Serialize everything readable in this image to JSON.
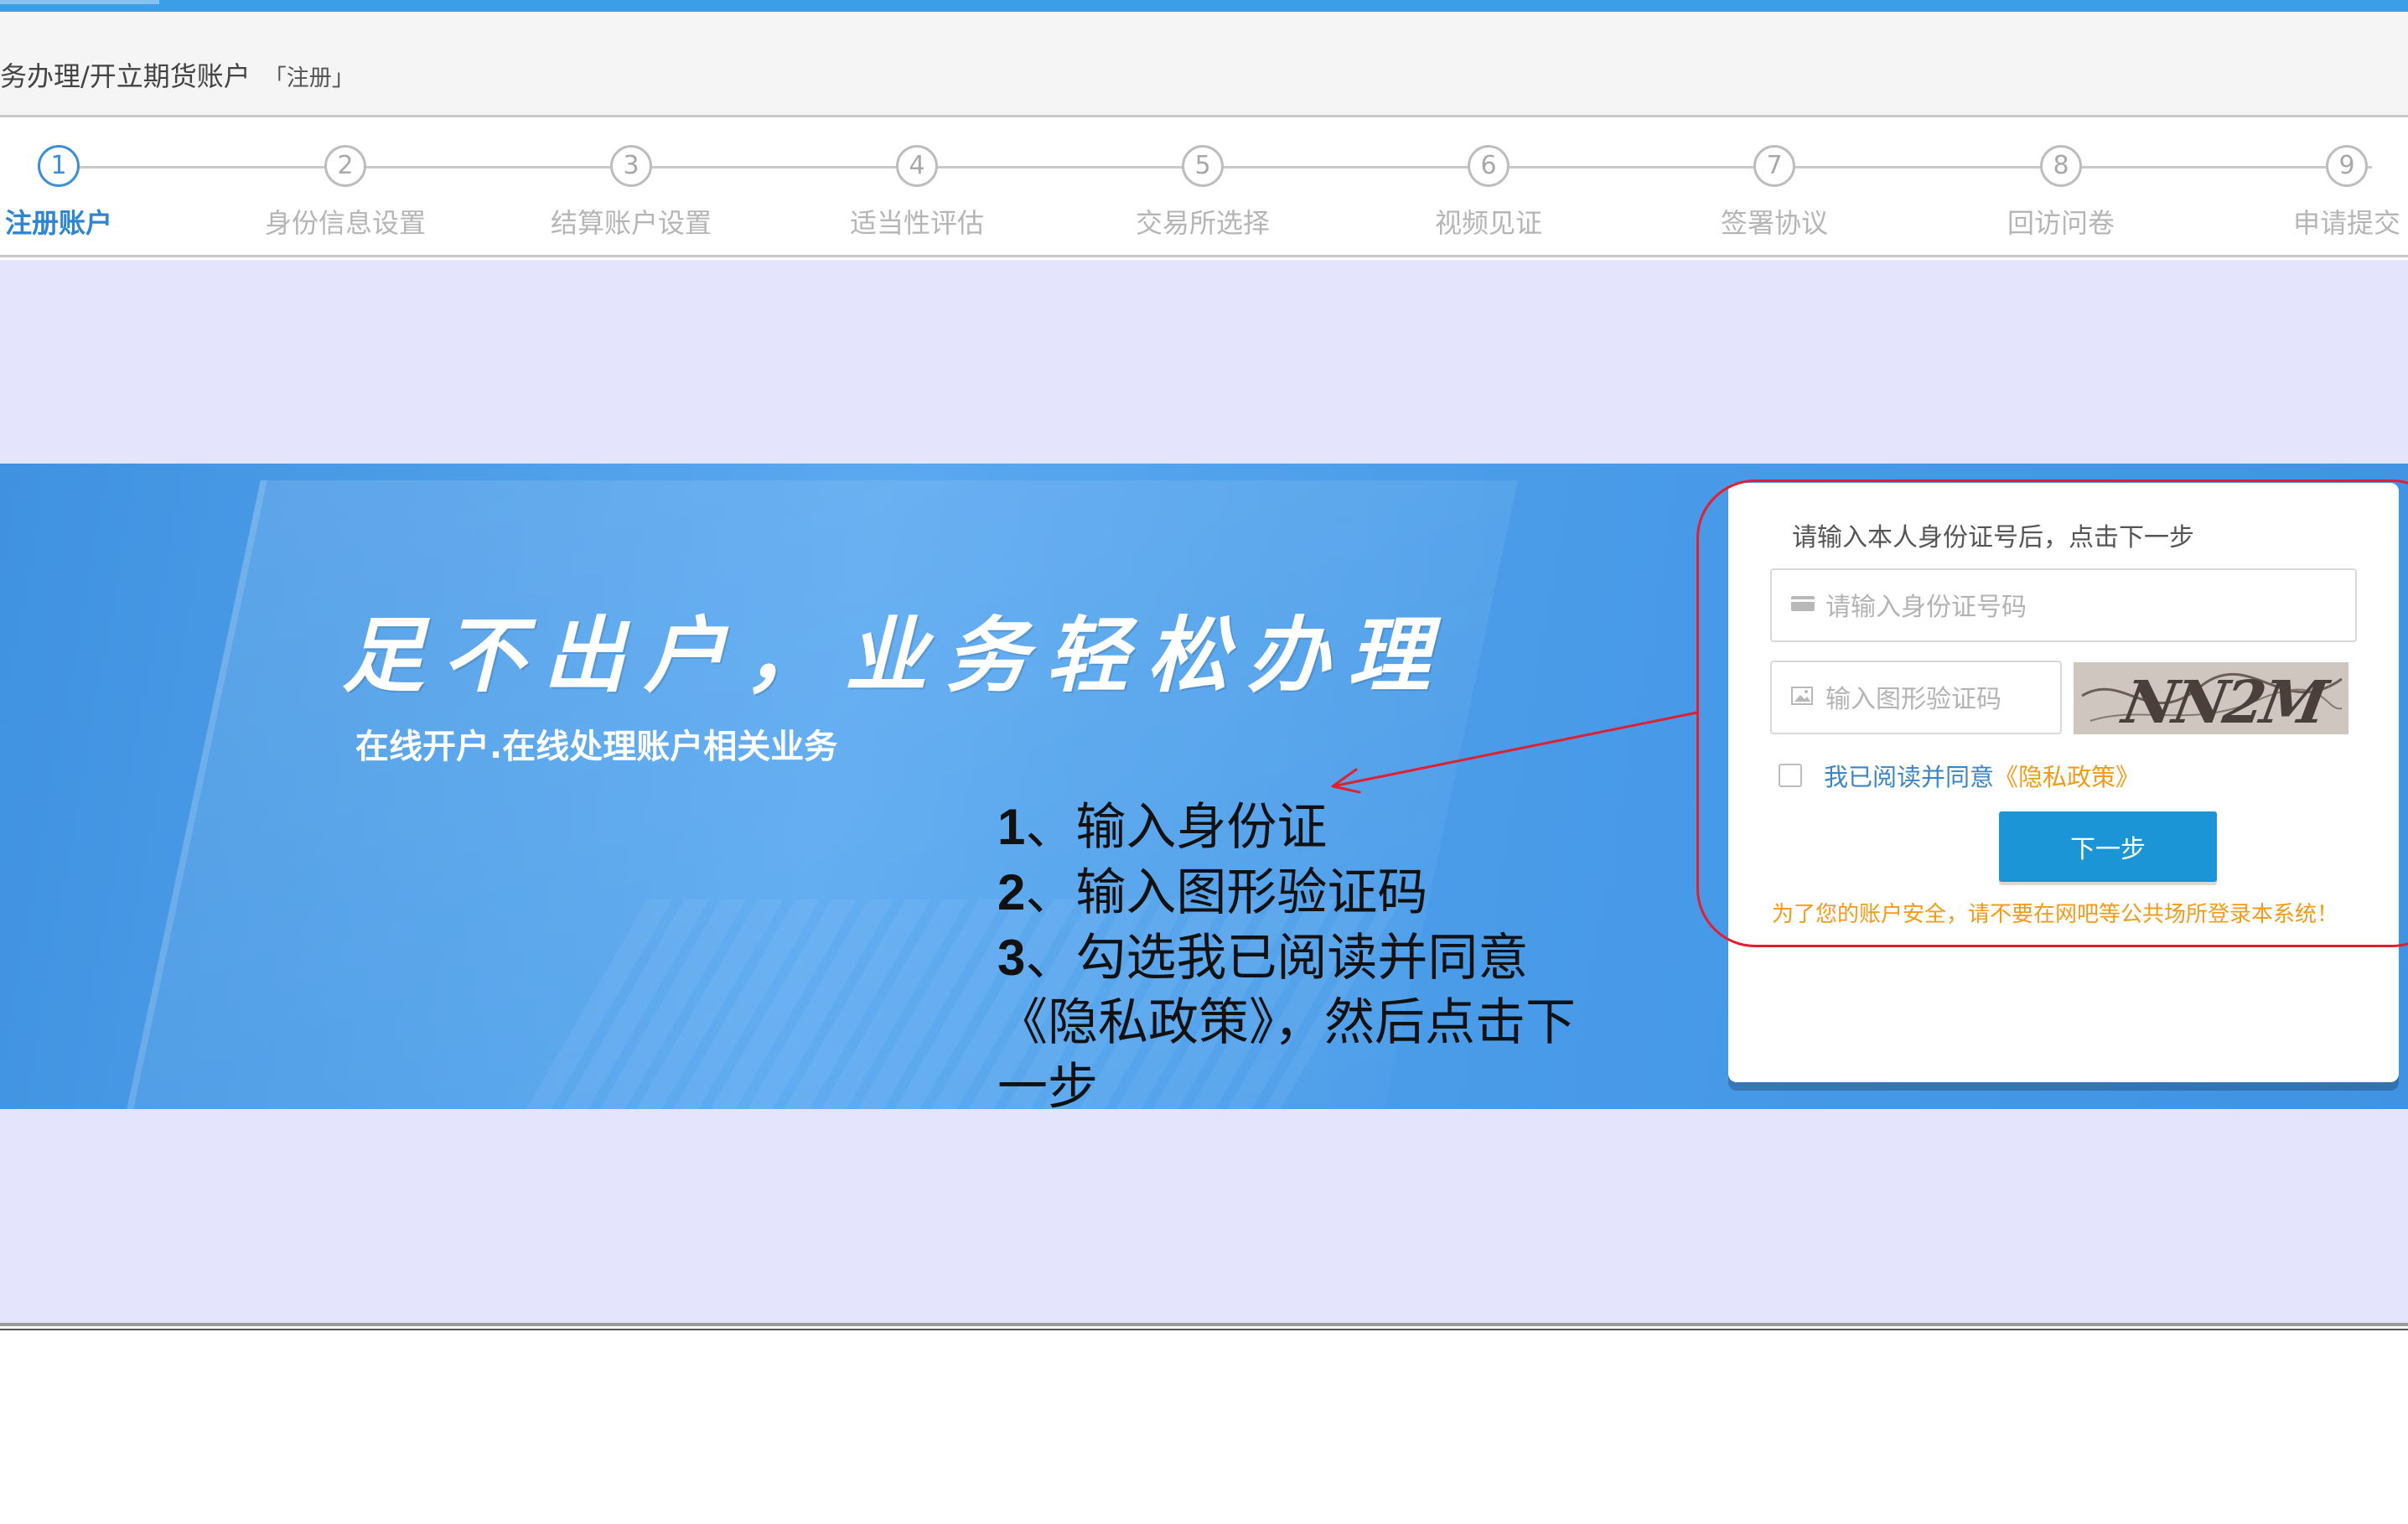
{
  "breadcrumb": {
    "path": "务办理/开立期货账户",
    "current": "「注册」"
  },
  "steps": [
    {
      "number": "1",
      "label": "注册账户",
      "active": true
    },
    {
      "number": "2",
      "label": "身份信息设置",
      "active": false
    },
    {
      "number": "3",
      "label": "结算账户设置",
      "active": false
    },
    {
      "number": "4",
      "label": "适当性评估",
      "active": false
    },
    {
      "number": "5",
      "label": "交易所选择",
      "active": false
    },
    {
      "number": "6",
      "label": "视频见证",
      "active": false
    },
    {
      "number": "7",
      "label": "签署协议",
      "active": false
    },
    {
      "number": "8",
      "label": "回访问卷",
      "active": false
    },
    {
      "number": "9",
      "label": "申请提交",
      "active": false
    }
  ],
  "banner": {
    "title": "足不出户，业务轻松办理",
    "subtitle": "在线开户.在线处理账户相关业务"
  },
  "login_card": {
    "instruction": "请输入本人身份证号后，点击下一步",
    "id_field": {
      "placeholder": "请输入身份证号码",
      "value": "",
      "icon": "id-card-icon"
    },
    "captcha_field": {
      "placeholder": "输入图形验证码",
      "value": "",
      "icon": "image-icon"
    },
    "captcha_image_text": "NN2M",
    "agree": {
      "checked": false,
      "text": "我已阅读并同意",
      "link": "《隐私政策》"
    },
    "next_button": "下一步",
    "warning": "为了您的账户安全，请不要在网吧等公共场所登录本系统！"
  },
  "annotation": {
    "lines": [
      {
        "num": "1",
        "text": "、输入身份证"
      },
      {
        "num": "2",
        "text": "、输入图形验证码"
      },
      {
        "num": "3",
        "text": "、勾选我已阅读并同意"
      },
      {
        "num": "",
        "text": "《隐私政策》，然后点击下"
      },
      {
        "num": "",
        "text": "一步"
      }
    ]
  },
  "colors": {
    "accent": "#3d9ee8",
    "active_step": "#2f85d0",
    "button": "#1b95d6",
    "warning": "#f39a18",
    "annotation": "#e02030",
    "content_bg": "#e5e4fd"
  }
}
